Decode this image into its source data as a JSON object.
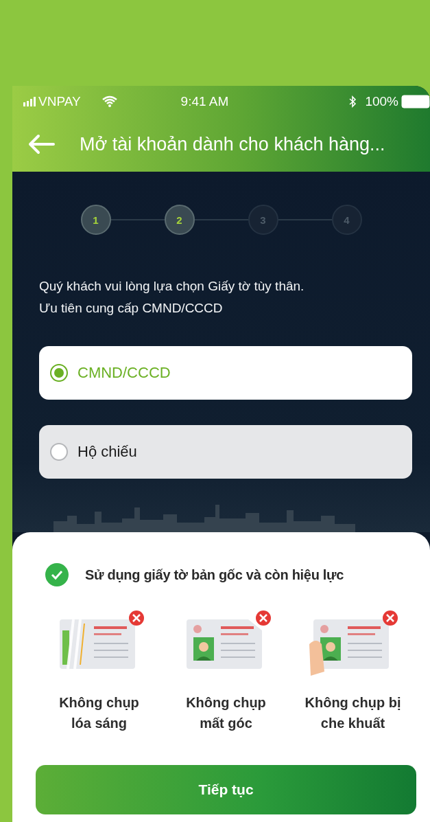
{
  "status_bar": {
    "carrier": "VNPAY",
    "time": "9:41 AM",
    "battery": "100%"
  },
  "header": {
    "title": "Mở tài khoản dành cho khách hàng..."
  },
  "steps": [
    {
      "label": "1",
      "active": true
    },
    {
      "label": "2",
      "active": true
    },
    {
      "label": "3",
      "active": false
    },
    {
      "label": "4",
      "active": false
    }
  ],
  "intro_lines": [
    "Quý khách vui lòng lựa chọn Giấy tờ tùy thân.",
    "Ưu tiên cung cấp CMND/CCCD"
  ],
  "options": [
    {
      "label": "CMND/CCCD",
      "selected": true
    },
    {
      "label": "Hộ chiếu",
      "selected": false
    }
  ],
  "notice": "Sử dụng giấy tờ bản gốc và còn hiệu lực",
  "tips": [
    {
      "kind": "glare",
      "label": "Không chụp lóa sáng"
    },
    {
      "kind": "corner",
      "label": "Không chụp mất góc"
    },
    {
      "kind": "covered",
      "label": "Không chụp bị che khuất"
    }
  ],
  "button": "Tiếp tục"
}
